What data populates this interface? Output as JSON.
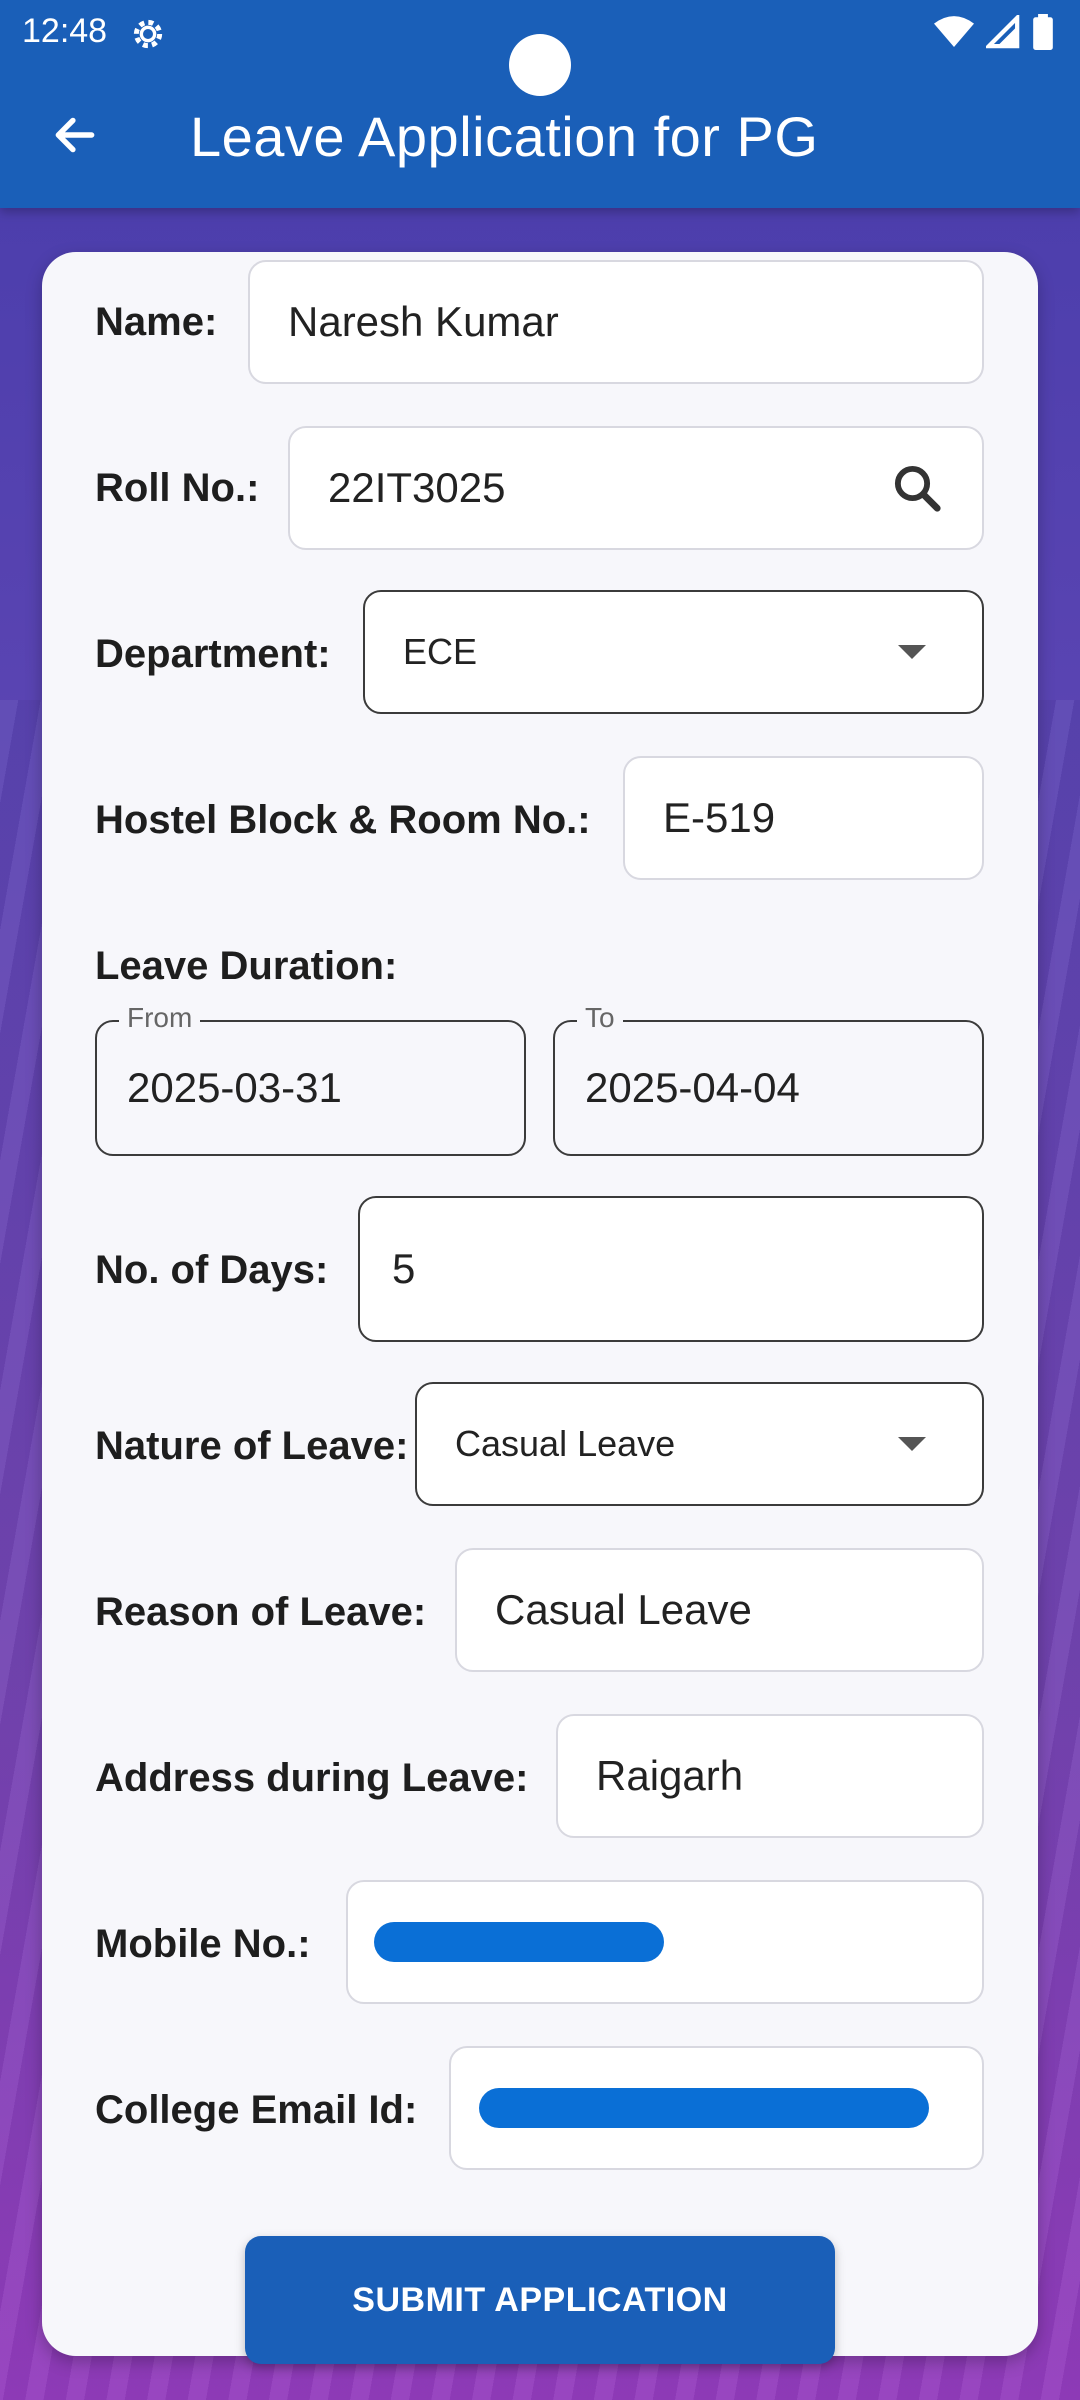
{
  "status_bar": {
    "time": "12:48"
  },
  "app_bar": {
    "title": "Leave Application for PG"
  },
  "form": {
    "name": {
      "label": "Name:",
      "value": "Naresh Kumar"
    },
    "roll_no": {
      "label": "Roll No.:",
      "value": "22IT3025"
    },
    "department": {
      "label": "Department:",
      "value": "ECE"
    },
    "hostel": {
      "label": "Hostel Block & Room No.:",
      "value": "E-519"
    },
    "leave_duration": {
      "label": "Leave Duration:",
      "from_label": "From",
      "from_value": "2025-03-31",
      "to_label": "To",
      "to_value": "2025-04-04"
    },
    "days": {
      "label": "No. of Days:",
      "value": "5"
    },
    "nature": {
      "label": "Nature of Leave:",
      "value": "Casual Leave"
    },
    "reason": {
      "label": "Reason of Leave:",
      "value": "Casual Leave"
    },
    "address": {
      "label": "Address during Leave:",
      "value": "Raigarh"
    },
    "mobile": {
      "label": "Mobile No.:"
    },
    "email": {
      "label": "College Email Id:"
    }
  },
  "submit_label": "SUBMIT APPLICATION",
  "colors": {
    "app_bar": "#1a5fb8",
    "redaction": "#0a6fd6",
    "card": "#f7f7fb"
  },
  "icons": [
    "settings-gear-icon",
    "wifi-icon",
    "signal-icon",
    "battery-icon",
    "back-arrow-icon",
    "search-icon",
    "dropdown-arrow-icon"
  ]
}
